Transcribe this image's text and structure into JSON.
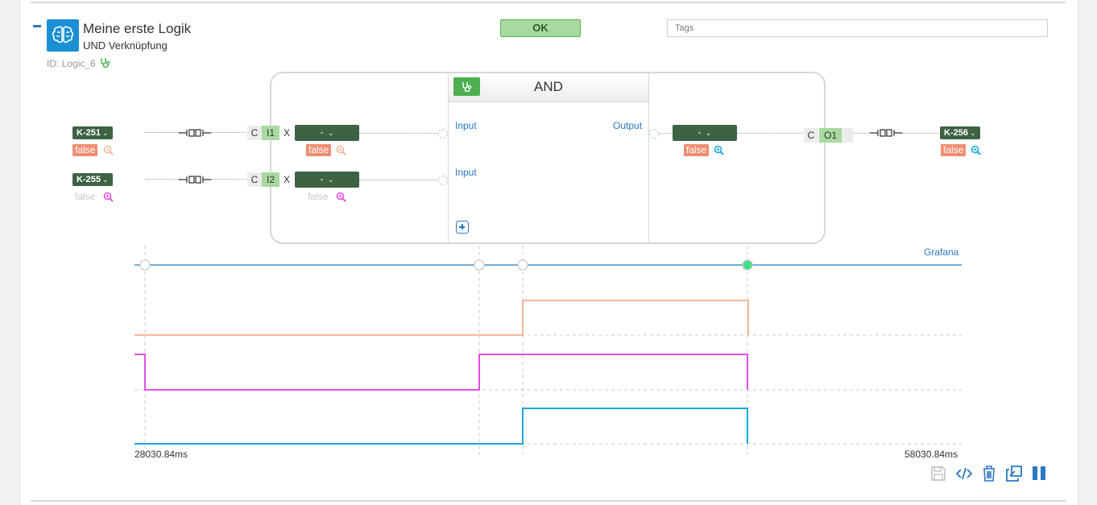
{
  "header": {
    "title": "Meine erste Logik",
    "subtitle": "UND Verknüpfung",
    "id_text": "ID: Logic_6",
    "status": "OK",
    "tags_placeholder": "Tags"
  },
  "block": {
    "title": "AND",
    "input1_label": "Input",
    "input2_label": "Input",
    "output_label": "Output"
  },
  "inputs": [
    {
      "ko": "K-251",
      "ko_value": "false",
      "c": "C",
      "port": "I1",
      "x": "X",
      "select": "-",
      "port_value": "false"
    },
    {
      "ko": "K-255",
      "ko_value": "false",
      "c": "C",
      "port": "I2",
      "x": "X",
      "select": "-",
      "port_value": "false"
    }
  ],
  "output": {
    "select": "-",
    "value": "false",
    "c": "C",
    "port": "O1",
    "ko": "K-256",
    "ko_value": "false"
  },
  "timeline": {
    "label": "Grafana",
    "start": "28030.84ms",
    "end": "58030.84ms"
  },
  "colors": {
    "in1": "#f4b79b",
    "in2": "#e64ee6",
    "out": "#1aa7d8",
    "ok_bg": "#a8d9a0",
    "dark_green": "#3e6244",
    "accent_blue": "#2a78c2"
  },
  "icons": [
    "brain-icon",
    "stethoscope-icon",
    "link-plug-icon",
    "zoom-icon",
    "save-icon",
    "code-icon",
    "trash-icon",
    "copy-icon",
    "pause-icon"
  ]
}
